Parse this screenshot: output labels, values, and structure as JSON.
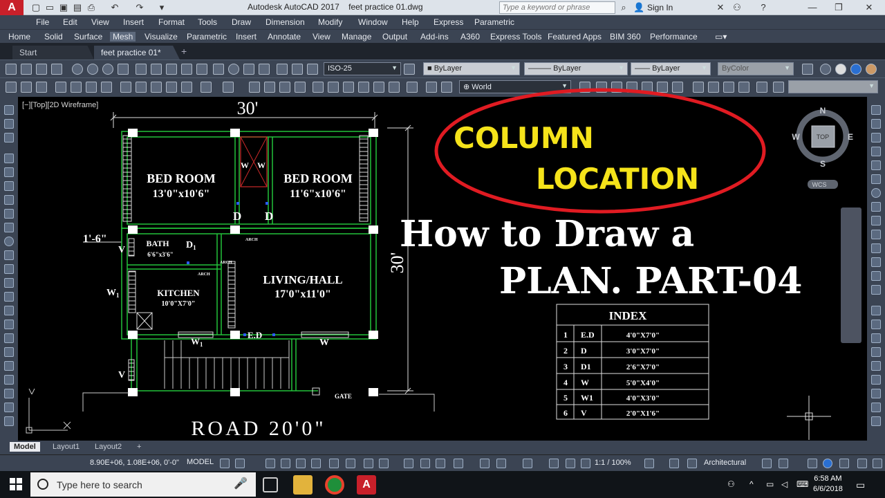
{
  "titlebar": {
    "app_title": "Autodesk AutoCAD 2017",
    "doc_title": "feet practice 01.dwg",
    "search_placeholder": "Type a keyword or phrase",
    "signin": "Sign In"
  },
  "menu": [
    "File",
    "Edit",
    "View",
    "Insert",
    "Format",
    "Tools",
    "Draw",
    "Dimension",
    "Modify",
    "Window",
    "Help",
    "Express",
    "Parametric"
  ],
  "ribbon_tabs": [
    "Home",
    "Solid",
    "Surface",
    "Mesh",
    "Visualize",
    "Parametric",
    "Insert",
    "Annotate",
    "View",
    "Manage",
    "Output",
    "Add-ins",
    "A360",
    "Express Tools",
    "Featured Apps",
    "BIM 360",
    "Performance"
  ],
  "ribbon_active": "Mesh",
  "doc_tabs": [
    {
      "label": "Start"
    },
    {
      "label": "feet practice 01*"
    }
  ],
  "toolbar": {
    "dimstyle": "ISO-25",
    "layer": "ByLayer",
    "linetype": "ByLayer",
    "lineweight": "ByLayer",
    "plotstyle": "ByColor",
    "ucs": "World"
  },
  "viewport_label": "[−][Top][2D Wireframe]",
  "viewcube": {
    "n": "N",
    "s": "S",
    "e": "E",
    "w": "W",
    "top": "TOP",
    "wcs": "WCS"
  },
  "drawing": {
    "dim_top": "30'",
    "dim_right": "30'",
    "dim_left": "1'-6\"",
    "bedroom1_name": "BED ROOM",
    "bedroom1_size": "13'0\"x10'6\"",
    "bedroom2_name": "BED ROOM",
    "bedroom2_size": "11'6\"x10'6\"",
    "bath_name": "BATH",
    "bath_size": "6'6\"x3'6\"",
    "kitchen_name": "KITCHEN",
    "kitchen_size": "10'0\"X7'0\"",
    "living_name": "LIVING/HALL",
    "living_size": "17'0\"x11'0\"",
    "label_d1": "D",
    "label_d2": "D",
    "label_d1_small": "D",
    "sub_1": "1",
    "label_ww": "W",
    "label_ww2": "W",
    "label_v1": "V",
    "label_v2": "V",
    "label_w1_left": "W",
    "label_w1_bottom": "W",
    "label_w_bottom": "W",
    "label_ed": "E.D",
    "arch1": "ARCH",
    "arch2": "ARCH",
    "arch3": "ARCH",
    "gate": "GATE",
    "road": "ROAD 20'0\""
  },
  "overlay": {
    "column": "COLUMN",
    "location": "LOCATION",
    "line1": "How to Draw a",
    "line2": "PLAN. PART-04"
  },
  "index_table": {
    "title": "INDEX",
    "rows": [
      {
        "no": "1",
        "code": "E.D",
        "size": "4'0\"X7'0\""
      },
      {
        "no": "2",
        "code": "D",
        "size": "3'0\"X7'0\""
      },
      {
        "no": "3",
        "code": "D1",
        "size": "2'6\"X7'0\""
      },
      {
        "no": "4",
        "code": "W",
        "size": "5'0\"X4'0\""
      },
      {
        "no": "5",
        "code": "W1",
        "size": "4'0\"X3'0\""
      },
      {
        "no": "6",
        "code": "V",
        "size": "2'0\"X1'6\""
      }
    ]
  },
  "layout_tabs": [
    "Model",
    "Layout1",
    "Layout2"
  ],
  "status": {
    "coords": "8.90E+06, 1.08E+06, 0'-0\"",
    "model": "MODEL",
    "scale": "1:1 / 100%",
    "units": "Architectural"
  },
  "taskbar": {
    "search": "Type here to search",
    "time": "6:58 AM",
    "date": "6/6/2018"
  }
}
